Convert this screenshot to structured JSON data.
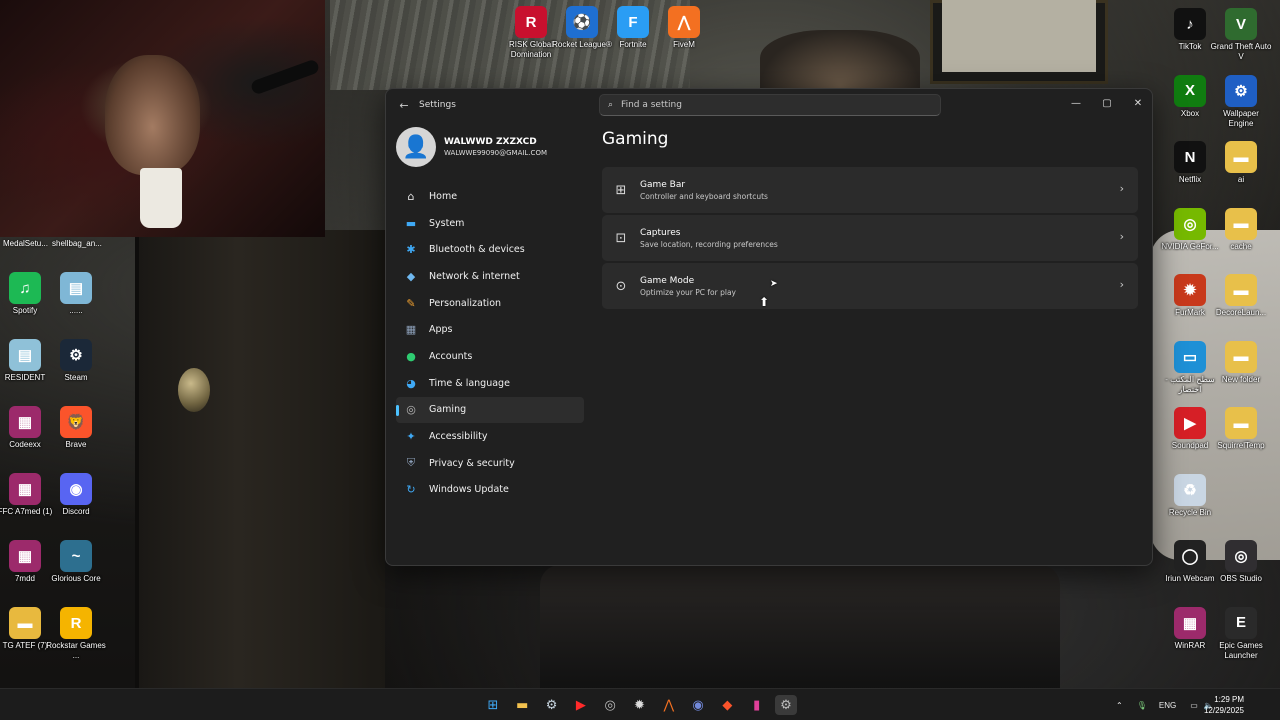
{
  "webcam_labels": [
    "MedalSetu...",
    "shellbag_an..."
  ],
  "desktop_left": [
    {
      "label": "Spotify",
      "icon": "spotify-icon",
      "color": "#1db954",
      "glyph": "♫"
    },
    {
      "label": "......",
      "icon": "file-icon",
      "color": "#7fb7d6",
      "glyph": "▤"
    },
    {
      "label": "RESIDENT",
      "icon": "file-icon",
      "color": "#8fc1d8",
      "glyph": "▤"
    },
    {
      "label": "Steam",
      "icon": "steam-icon",
      "color": "#1b2838",
      "glyph": "⚙"
    },
    {
      "label": "Codeexx",
      "icon": "winrar-icon",
      "color": "#9c2a6b",
      "glyph": "▦"
    },
    {
      "label": "Brave",
      "icon": "brave-icon",
      "color": "#fb542b",
      "glyph": "🦁"
    },
    {
      "label": "FFC A7med (1)",
      "icon": "winrar-icon",
      "color": "#9c2a6b",
      "glyph": "▦"
    },
    {
      "label": "Discord",
      "icon": "discord-icon",
      "color": "#5865f2",
      "glyph": "◉"
    },
    {
      "label": "7mdd",
      "icon": "winrar-icon",
      "color": "#9c2a6b",
      "glyph": "▦"
    },
    {
      "label": "Glorious Core",
      "icon": "glorious-icon",
      "color": "#2d6f8f",
      "glyph": "~"
    },
    {
      "label": "TG ATEF (7)",
      "icon": "folder-icon",
      "color": "#e8b93e",
      "glyph": "▬"
    },
    {
      "label": "Rockstar Games ...",
      "icon": "rockstar-icon",
      "color": "#f5b400",
      "glyph": "R"
    }
  ],
  "desktop_top": [
    {
      "label": "RISK Global Domination",
      "icon": "risk-icon",
      "color": "#c8102e",
      "glyph": "R"
    },
    {
      "label": "Rocket League®",
      "icon": "rocket-league-icon",
      "color": "#1f6fd1",
      "glyph": "⚽"
    },
    {
      "label": "Fortnite",
      "icon": "fortnite-icon",
      "color": "#2a9df4",
      "glyph": "F"
    },
    {
      "label": "FiveM",
      "icon": "fivem-icon",
      "color": "#f37021",
      "glyph": "⋀"
    }
  ],
  "desktop_right": [
    {
      "label": "TikTok",
      "icon": "tiktok-icon",
      "color": "#111111",
      "glyph": "♪"
    },
    {
      "label": "Grand Theft Auto V",
      "icon": "gta-icon",
      "color": "#2f6b2f",
      "glyph": "V"
    },
    {
      "label": "Xbox",
      "icon": "xbox-icon",
      "color": "#107c10",
      "glyph": "X"
    },
    {
      "label": "Wallpaper Engine",
      "icon": "wallpaper-engine-icon",
      "color": "#1f5fc4",
      "glyph": "⚙"
    },
    {
      "label": "Netflix",
      "icon": "netflix-icon",
      "color": "#111111",
      "glyph": "N"
    },
    {
      "label": "ai",
      "icon": "folder-icon",
      "color": "#e8c04a",
      "glyph": "▬"
    },
    {
      "label": "NVIDIA GeFor...",
      "icon": "nvidia-icon",
      "color": "#76b900",
      "glyph": "◎"
    },
    {
      "label": "cache",
      "icon": "folder-icon",
      "color": "#e8c04a",
      "glyph": "▬"
    },
    {
      "label": "FurMark",
      "icon": "furmark-icon",
      "color": "#c8391b",
      "glyph": "✹"
    },
    {
      "label": "DecoreLaun...",
      "icon": "folder-icon",
      "color": "#e8c04a",
      "glyph": "▬"
    },
    {
      "label": "سطح المكتب - اختصار",
      "icon": "desktop-shortcut-icon",
      "color": "#1e90d6",
      "glyph": "▭"
    },
    {
      "label": "New folder",
      "icon": "folder-icon",
      "color": "#e8c04a",
      "glyph": "▬"
    },
    {
      "label": "Soundpad",
      "icon": "soundpad-icon",
      "color": "#d61f26",
      "glyph": "▶"
    },
    {
      "label": "SquirrelTemp",
      "icon": "folder-icon",
      "color": "#e8c04a",
      "glyph": "▬"
    },
    {
      "label": "Recycle Bin",
      "icon": "recycle-bin-icon",
      "color": "#c9d6e3",
      "glyph": "♻"
    },
    {
      "label": "",
      "icon": "",
      "color": "",
      "glyph": ""
    },
    {
      "label": "Iriun Webcam",
      "icon": "iriun-icon",
      "color": "#222222",
      "glyph": "◯"
    },
    {
      "label": "OBS Studio",
      "icon": "obs-icon",
      "color": "#302e31",
      "glyph": "◎"
    },
    {
      "label": "WinRAR",
      "icon": "winrar-icon",
      "color": "#9c2a6b",
      "glyph": "▦"
    },
    {
      "label": "Epic Games Launcher",
      "icon": "epic-games-icon",
      "color": "#2a2a2a",
      "glyph": "E"
    }
  ],
  "settings": {
    "app_title": "Settings",
    "search_placeholder": "Find a setting",
    "user_name": "WALWWD ZXZXCD",
    "user_email": "WALWWE99090@GMAIL.COM",
    "nav": [
      {
        "label": "Home",
        "icon": "home-icon",
        "glyph": "⌂",
        "color": "#e0e0e0"
      },
      {
        "label": "System",
        "icon": "system-icon",
        "glyph": "▬",
        "color": "#3fa9f5"
      },
      {
        "label": "Bluetooth & devices",
        "icon": "bluetooth-icon",
        "glyph": "✱",
        "color": "#3fa9f5"
      },
      {
        "label": "Network & internet",
        "icon": "network-icon",
        "glyph": "◆",
        "color": "#6fb8f0"
      },
      {
        "label": "Personalization",
        "icon": "brush-icon",
        "glyph": "✎",
        "color": "#f0a030"
      },
      {
        "label": "Apps",
        "icon": "apps-icon",
        "glyph": "▦",
        "color": "#8c9fb8"
      },
      {
        "label": "Accounts",
        "icon": "accounts-icon",
        "glyph": "●",
        "color": "#2ecc71"
      },
      {
        "label": "Time & language",
        "icon": "globe-icon",
        "glyph": "◕",
        "color": "#3fa9f5"
      },
      {
        "label": "Gaming",
        "icon": "gaming-icon",
        "glyph": "◎",
        "color": "#bbbbbb"
      },
      {
        "label": "Accessibility",
        "icon": "accessibility-icon",
        "glyph": "✦",
        "color": "#3fa9f5"
      },
      {
        "label": "Privacy & security",
        "icon": "shield-icon",
        "glyph": "⛨",
        "color": "#8c9fb8"
      },
      {
        "label": "Windows Update",
        "icon": "update-icon",
        "glyph": "↻",
        "color": "#3fa9f5"
      }
    ],
    "active_nav": "Gaming",
    "page_title": "Gaming",
    "cards": [
      {
        "title": "Game Bar",
        "subtitle": "Controller and keyboard shortcuts",
        "icon": "game-bar-icon",
        "glyph": "⊞"
      },
      {
        "title": "Captures",
        "subtitle": "Save location, recording preferences",
        "icon": "captures-icon",
        "glyph": "⊡"
      },
      {
        "title": "Game Mode",
        "subtitle": "Optimize your PC for play",
        "icon": "game-mode-icon",
        "glyph": "⊙"
      }
    ]
  },
  "taskbar": {
    "apps": [
      {
        "icon": "windows-start-icon",
        "glyph": "⊞",
        "color": "#3fa9f5"
      },
      {
        "icon": "file-explorer-icon",
        "glyph": "▬",
        "color": "#f2c14e"
      },
      {
        "icon": "steam-icon",
        "glyph": "⚙",
        "color": "#c7d5e0"
      },
      {
        "icon": "youtube-icon",
        "glyph": "▶",
        "color": "#ff2a2a"
      },
      {
        "icon": "chrome-icon",
        "glyph": "◎",
        "color": "#bbbbbb"
      },
      {
        "icon": "settings-gear-icon",
        "glyph": "✹",
        "color": "#dddddd"
      },
      {
        "icon": "fivem-icon",
        "glyph": "⋀",
        "color": "#f37021"
      },
      {
        "icon": "discord-icon",
        "glyph": "◉",
        "color": "#7289da"
      },
      {
        "icon": "brave-icon",
        "glyph": "◆",
        "color": "#fb542b"
      },
      {
        "icon": "app-icon",
        "glyph": "▮",
        "color": "#e0409a"
      },
      {
        "icon": "settings-icon",
        "glyph": "⚙",
        "color": "#bcbcbc"
      }
    ],
    "language": "ENG",
    "time": "1:29 PM",
    "date": "12/29/2025"
  }
}
